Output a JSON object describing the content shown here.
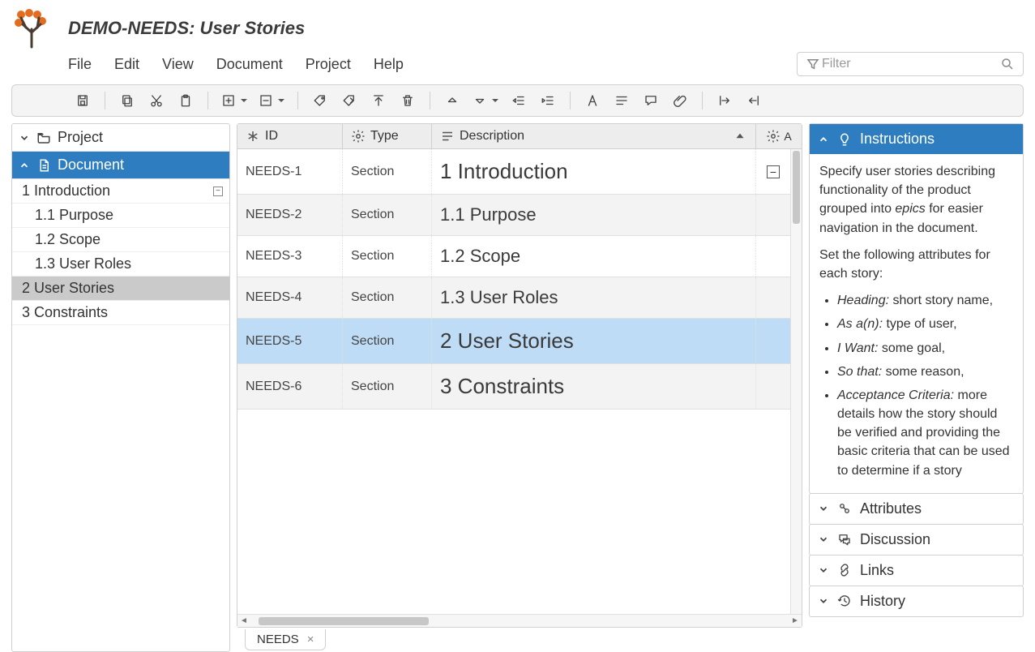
{
  "header": {
    "title": "DEMO-NEEDS: User Stories",
    "menu": [
      "File",
      "Edit",
      "View",
      "Document",
      "Project",
      "Help"
    ],
    "filter_placeholder": "Filter"
  },
  "toolbar_groups": [
    [
      "save"
    ],
    [
      "copy",
      "cut",
      "paste"
    ],
    [
      "add-row",
      "remove-row"
    ],
    [
      "tag",
      "tag-forward",
      "tag-up",
      "delete"
    ],
    [
      "move-up",
      "move-down",
      "outdent",
      "indent"
    ],
    [
      "format-text",
      "align",
      "comment",
      "attachment"
    ],
    [
      "expand-width",
      "collapse-width"
    ]
  ],
  "nav": {
    "project_label": "Project",
    "document_label": "Document",
    "items": [
      {
        "label": "1 Introduction",
        "level": 1,
        "toggle": "−"
      },
      {
        "label": "1.1 Purpose",
        "level": 2
      },
      {
        "label": "1.2 Scope",
        "level": 2
      },
      {
        "label": "1.3 User Roles",
        "level": 2
      },
      {
        "label": "2 User Stories",
        "level": 1,
        "selected": true
      },
      {
        "label": "3 Constraints",
        "level": 1
      }
    ]
  },
  "table": {
    "columns": {
      "id": "ID",
      "type": "Type",
      "desc": "Description"
    },
    "rows": [
      {
        "id": "NEEDS-1",
        "type": "Section",
        "desc": "1 Introduction",
        "level": 1,
        "collapsible": true
      },
      {
        "id": "NEEDS-2",
        "type": "Section",
        "desc": "1.1 Purpose",
        "level": 2
      },
      {
        "id": "NEEDS-3",
        "type": "Section",
        "desc": "1.2 Scope",
        "level": 2
      },
      {
        "id": "NEEDS-4",
        "type": "Section",
        "desc": "1.3 User Roles",
        "level": 2
      },
      {
        "id": "NEEDS-5",
        "type": "Section",
        "desc": "2 User Stories",
        "level": 1,
        "selected": true
      },
      {
        "id": "NEEDS-6",
        "type": "Section",
        "desc": "3 Constraints",
        "level": 1
      }
    ]
  },
  "tabs": [
    {
      "label": "NEEDS"
    }
  ],
  "side": {
    "instructions": {
      "title": "Instructions",
      "intro1_a": "Specify user stories describing functionality of the product grouped into ",
      "intro1_em": "epics",
      "intro1_b": " for easier navigation in the document.",
      "intro2": "Set the following attributes for each story:",
      "bullets": [
        {
          "term": "Heading:",
          "text": " short story name,"
        },
        {
          "term": "As a(n):",
          "text": " type of user,"
        },
        {
          "term": "I Want:",
          "text": " some goal,"
        },
        {
          "term": "So that:",
          "text": " some reason,"
        },
        {
          "term": "Acceptance Criteria:",
          "text": " more details how the story should be verified and providing the basic criteria that can be used to determine if a story"
        }
      ]
    },
    "others": [
      "Attributes",
      "Discussion",
      "Links",
      "History"
    ]
  }
}
